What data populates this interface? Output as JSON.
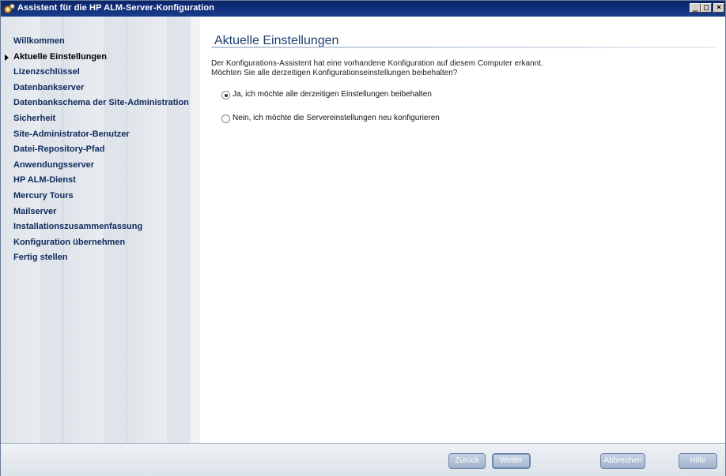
{
  "window": {
    "title": "Assistent für die HP ALM-Server-Konfiguration",
    "controls": {
      "minimize": "_",
      "maximize": "□",
      "close": "×"
    }
  },
  "sidebar": {
    "items": [
      {
        "label": "Willkommen",
        "active": false
      },
      {
        "label": "Aktuelle Einstellungen",
        "active": true
      },
      {
        "label": "Lizenzschlüssel",
        "active": false
      },
      {
        "label": "Datenbankserver",
        "active": false
      },
      {
        "label": "Datenbankschema der Site-Administration",
        "active": false
      },
      {
        "label": "Sicherheit",
        "active": false
      },
      {
        "label": "Site-Administrator-Benutzer",
        "active": false
      },
      {
        "label": "Datei-Repository-Pfad",
        "active": false
      },
      {
        "label": "Anwendungsserver",
        "active": false
      },
      {
        "label": "HP ALM-Dienst",
        "active": false
      },
      {
        "label": "Mercury Tours",
        "active": false
      },
      {
        "label": "Mailserver",
        "active": false
      },
      {
        "label": "Installationszusammenfassung",
        "active": false
      },
      {
        "label": "Konfiguration übernehmen",
        "active": false
      },
      {
        "label": "Fertig stellen",
        "active": false
      }
    ]
  },
  "main": {
    "title": "Aktuelle Einstellungen",
    "description_line1": "Der Konfigurations-Assistent hat eine vorhandene Konfiguration auf diesem Computer erkannt.",
    "description_line2": "Möchten Sie alle derzeitigen Konfigurationseinstellungen beibehalten?",
    "options": [
      {
        "label": "Ja, ich möchte alle derzeitigen Einstellungen beibehalten",
        "selected": true
      },
      {
        "label": "Nein, ich möchte die Servereinstellungen neu konfigurieren",
        "selected": false
      }
    ]
  },
  "footer": {
    "back_label": "Zurück",
    "next_label": "Weiter",
    "cancel_label": "Abbrechen",
    "help_label": "Hilfe"
  },
  "colors": {
    "titlebar": "#0a246a",
    "nav_text": "#0f2a5c",
    "heading": "#1c3f6e",
    "button": "#a3b6cf"
  },
  "icons": {
    "app": "wizard-gears-icon",
    "active_marker": "triangle-right-icon"
  }
}
